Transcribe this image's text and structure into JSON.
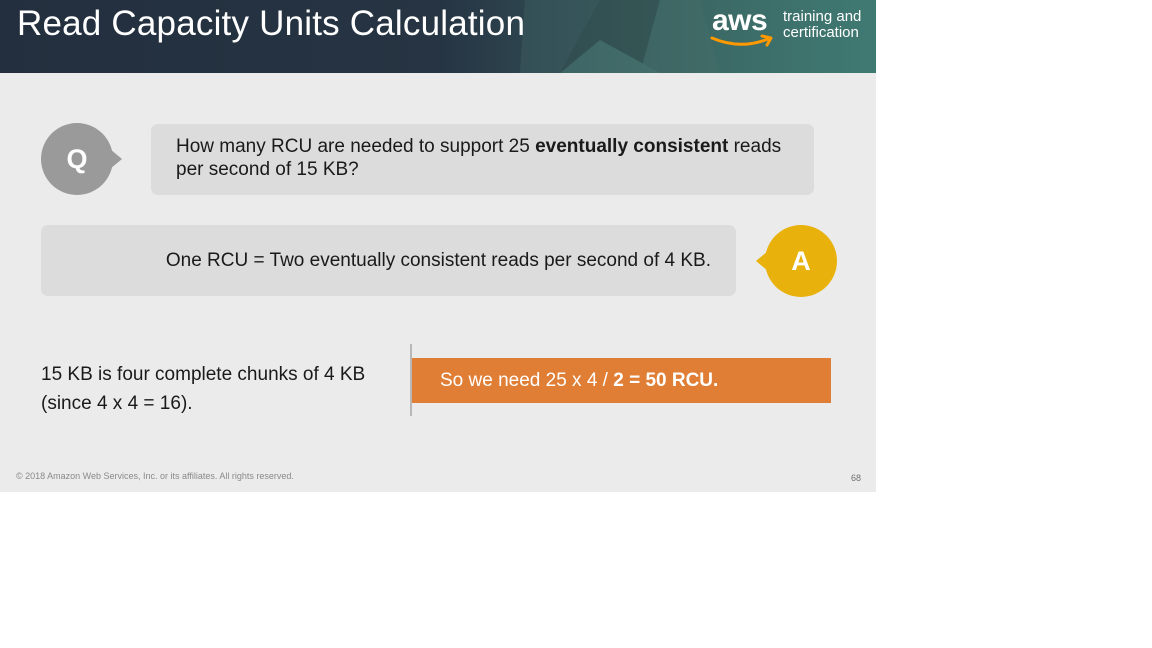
{
  "header": {
    "title": "Read Capacity Units Calculation",
    "logo": {
      "word": "aws",
      "line1": "training and",
      "line2": "certification"
    }
  },
  "question": {
    "badge": "Q",
    "text_before": "How many RCU are needed to support 25 ",
    "text_bold": "eventually consistent",
    "text_after": " reads per second of 15 KB?"
  },
  "answer": {
    "badge": "A",
    "text": "One RCU = Two eventually consistent reads per second of 4 KB."
  },
  "explanation": {
    "line1": "15 KB is four complete chunks of 4 KB",
    "line2": "(since 4 x 4 = 16)."
  },
  "result": {
    "text_before": "So we need 25 x 4 / ",
    "text_bold": "2 = 50 RCU."
  },
  "footer": {
    "copyright": "© 2018 Amazon Web Services, Inc. or its affiliates. All rights reserved.",
    "page_number": "68"
  },
  "colors": {
    "header_bg": "#232f3e",
    "slide_bg": "#ebebeb",
    "callout_bg": "#dcdcdc",
    "q_badge": "#9a9a9a",
    "a_badge": "#e8b10b",
    "result_bg": "#e07e35"
  },
  "icons": [
    "aws-smile-icon"
  ]
}
